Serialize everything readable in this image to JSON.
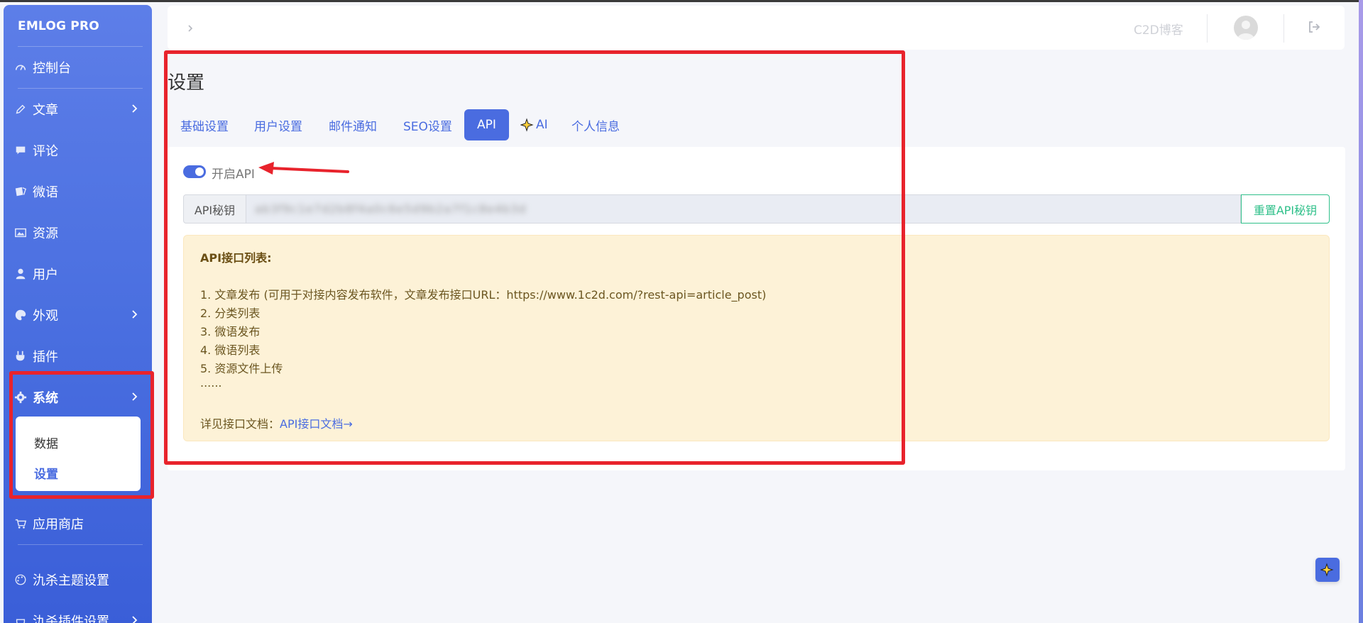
{
  "sidebar": {
    "brand": "EMLOG PRO",
    "items": [
      {
        "label": "控制台",
        "icon": "dashboard-icon"
      },
      {
        "label": "文章",
        "icon": "pencil-icon",
        "chevron": true
      },
      {
        "label": "评论",
        "icon": "comment-icon"
      },
      {
        "label": "微语",
        "icon": "notes-icon"
      },
      {
        "label": "资源",
        "icon": "image-icon"
      },
      {
        "label": "用户",
        "icon": "user-icon"
      },
      {
        "label": "外观",
        "icon": "palette-icon",
        "chevron": true
      },
      {
        "label": "插件",
        "icon": "plug-icon"
      },
      {
        "label": "系统",
        "icon": "gear-icon",
        "chevron": true,
        "active": true
      },
      {
        "label": "应用商店",
        "icon": "cart-icon"
      },
      {
        "label": "氿杀主题设置",
        "icon": "palette-outline-icon"
      },
      {
        "label": "氿杀插件设置",
        "icon": "plug-outline-icon",
        "chevron": true
      }
    ],
    "submenu": {
      "data": "数据",
      "settings": "设置"
    }
  },
  "header": {
    "site_name": "C2D博客"
  },
  "main": {
    "title": "设置",
    "tabs": [
      "基础设置",
      "用户设置",
      "邮件通知",
      "SEO设置",
      "API",
      "AI",
      "个人信息"
    ],
    "active_tab": "API",
    "toggle_label": "开启API",
    "toggle_on": true,
    "key_label": "API秘钥",
    "key_value": "ab3f9c1e7d2b8f4a0c6e5d9b2a7f1c8e4b3d",
    "reset_button": "重置API秘钥",
    "api_list": {
      "heading": "API接口列表:",
      "items": [
        "1. 文章发布 (可用于对接内容发布软件，文章发布接口URL：https://www.1c2d.com/?rest-api=article_post)",
        "2. 分类列表",
        "3. 微语发布",
        "4. 微语列表",
        "5. 资源文件上传",
        "......"
      ],
      "doc_prefix": "详见接口文档：",
      "doc_link": "API接口文档→"
    }
  },
  "colors": {
    "accent": "#4a6ce0",
    "highlight": "#e8232c",
    "success": "#2fc08a",
    "notice_bg": "#fdf2d7"
  }
}
